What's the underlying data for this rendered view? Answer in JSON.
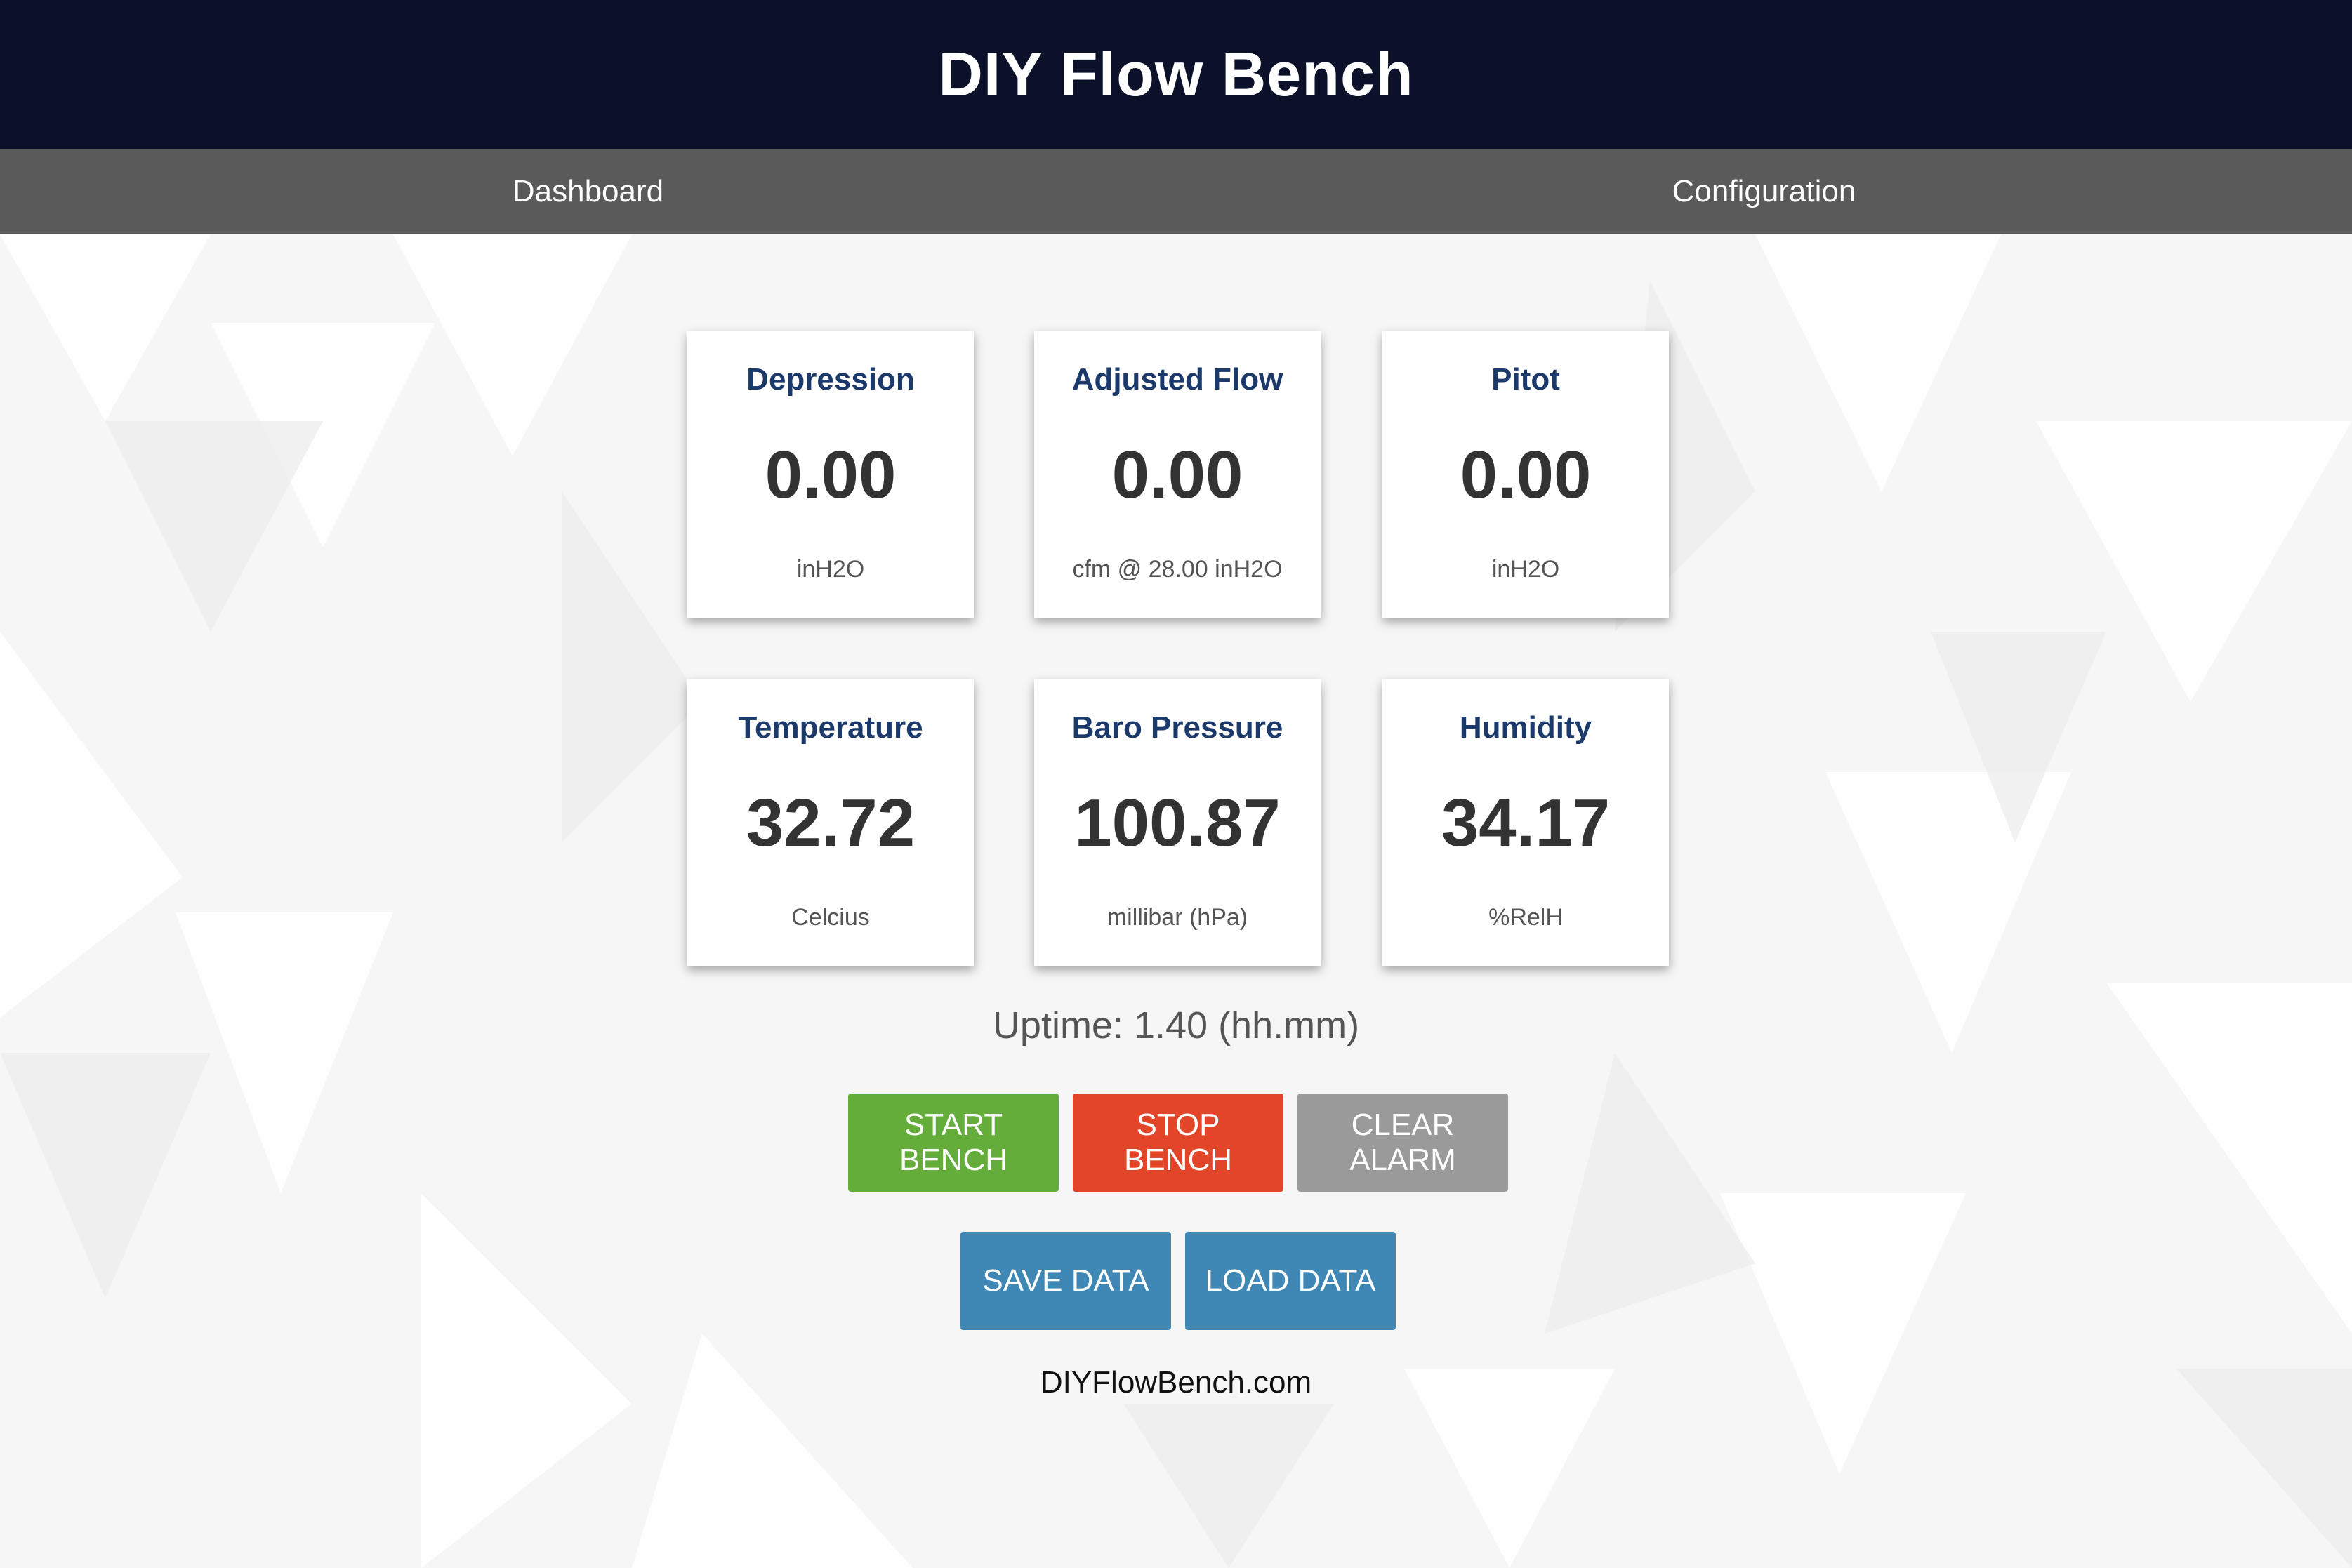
{
  "header": {
    "title": "DIY Flow Bench"
  },
  "nav": {
    "dashboard_label": "Dashboard",
    "configuration_label": "Configuration"
  },
  "tiles": [
    {
      "title": "Depression",
      "value": "0.00",
      "unit": "inH2O"
    },
    {
      "title": "Adjusted Flow",
      "value": "0.00",
      "unit": "cfm @ 28.00 inH2O"
    },
    {
      "title": "Pitot",
      "value": "0.00",
      "unit": "inH2O"
    },
    {
      "title": "Temperature",
      "value": "32.72",
      "unit": "Celcius"
    },
    {
      "title": "Baro Pressure",
      "value": "100.87",
      "unit": "millibar (hPa)"
    },
    {
      "title": "Humidity",
      "value": "34.17",
      "unit": "%RelH"
    }
  ],
  "status": {
    "uptime": "Uptime: 1.40 (hh.mm)"
  },
  "buttons": {
    "start": [
      "START",
      "BENCH"
    ],
    "stop": [
      "STOP",
      "BENCH"
    ],
    "clear": [
      "CLEAR",
      "ALARM"
    ],
    "save": "SAVE DATA",
    "load": "LOAD DATA"
  },
  "footer": {
    "text": "DIYFlowBench.com"
  },
  "colors": {
    "header_bg": "#0b1128",
    "nav_bg": "#5a5a5a",
    "tile_title": "#1b3a6b",
    "start": "#64ad3a",
    "stop": "#e34528",
    "clear": "#9a9a9a",
    "save_load": "#3f88b6"
  }
}
